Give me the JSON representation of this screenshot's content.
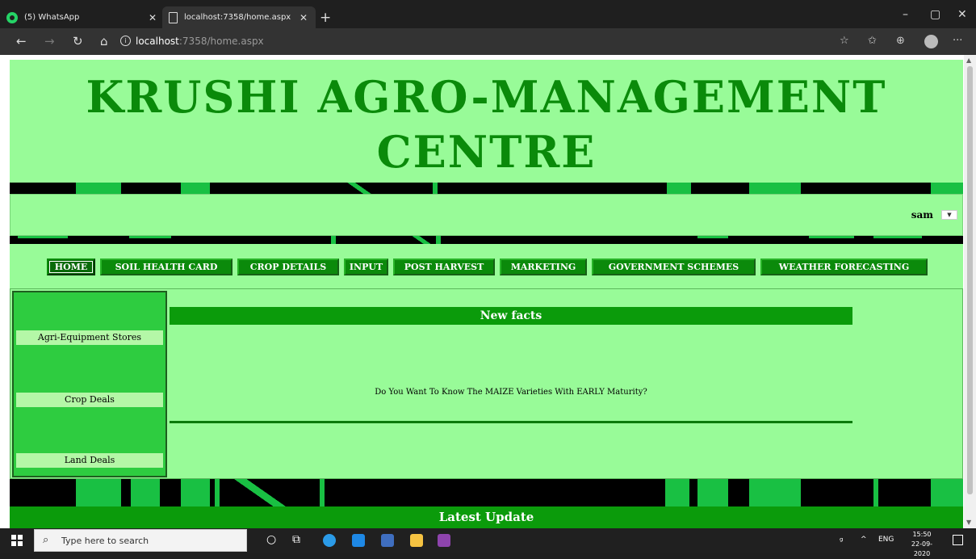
{
  "browser": {
    "tabs": [
      {
        "label": "(5) WhatsApp",
        "icon": "whatsapp-icon"
      },
      {
        "label": "localhost:7358/home.aspx",
        "icon": "page-icon"
      }
    ],
    "new_tab": "+",
    "url_host": "localhost",
    "url_rest": ":7358/home.aspx",
    "controls": {
      "minimize": "–",
      "maximize": "▢",
      "close": "✕"
    },
    "nav": {
      "back": "←",
      "forward": "→",
      "refresh": "↻",
      "home": "⌂"
    },
    "toolbar": {
      "favorite": "☆",
      "favorites": "✩",
      "collections": "⊕",
      "more": "···"
    }
  },
  "site": {
    "title_line1": "KRUSHI AGRO-MANAGEMENT",
    "title_line2": "CENTRE",
    "user": "sam",
    "user_menu_arrow": "▼",
    "menu": [
      {
        "label": "HOME",
        "active": true
      },
      {
        "label": "SOIL HEALTH CARD",
        "active": false
      },
      {
        "label": "CROP DETAILS",
        "active": false
      },
      {
        "label": "INPUT",
        "active": false
      },
      {
        "label": "POST HARVEST",
        "active": false
      },
      {
        "label": "MARKETING",
        "active": false
      },
      {
        "label": "GOVERNMENT SCHEMES",
        "active": false
      },
      {
        "label": "WEATHER FORECASTING",
        "active": false
      }
    ],
    "sidebar": [
      "Agri-Equipment Stores",
      "Crop Deals",
      "Land Deals"
    ],
    "facts_heading": "New facts",
    "facts_text": "Do You Want To Know The MAIZE Varieties With EARLY Maturity?",
    "latest_heading": "Latest Update",
    "colors": {
      "page_bg": "#98fb98",
      "title": "#0a8a0a",
      "menu_bg": "#0b8a0b",
      "accent": "#0b9b0b",
      "band_green": "#19c043"
    }
  },
  "taskbar": {
    "search_placeholder": "Type here to search",
    "language": "ENG",
    "time": "15:50",
    "date": "22-09-2020",
    "tray_up": "^"
  }
}
